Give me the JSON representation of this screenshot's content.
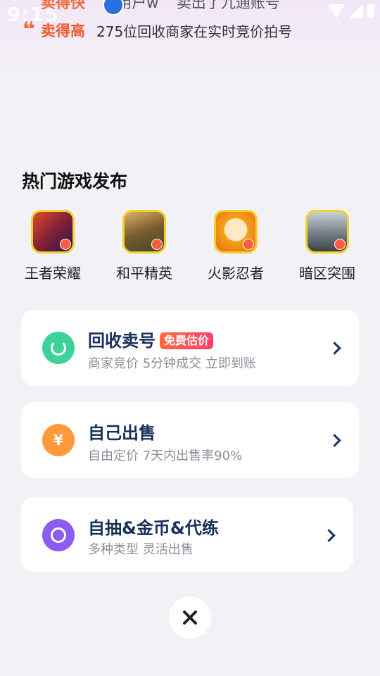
{
  "status_bar": {
    "time": "9:15",
    "icons": [
      "image-icon",
      "download-icon",
      "font-icon",
      "wifi-icon",
      "signal-icon",
      "battery-icon"
    ]
  },
  "ticker": {
    "prev_highlight": "卖得快",
    "prev_user": "用户w",
    "prev_text": "卖出了九通账号",
    "highlight": "卖得高",
    "text": "275位回收商家在实时竞价拍号"
  },
  "hot_games": {
    "title": "热门游戏发布",
    "items": [
      {
        "label": "王者荣耀",
        "color": "#c9402f"
      },
      {
        "label": "和平精英",
        "color": "#7a5a2e"
      },
      {
        "label": "火影忍者",
        "color": "#f3a21a"
      },
      {
        "label": "暗区突围",
        "color": "#5a6670"
      }
    ]
  },
  "cards": [
    {
      "title": "回收卖号",
      "badge": "免费估价",
      "subtitle": "商家竞价 5分钟成交 立即到账",
      "icon": "recycle-icon",
      "color": "#3ed19a"
    },
    {
      "title": "自己出售",
      "subtitle": "自由定价 7天内出售率90%",
      "icon": "yen-icon",
      "icon_text": "¥",
      "color": "#ff9a3c"
    },
    {
      "title": "自抽&金币&代练",
      "subtitle": "多种类型 灵活出售",
      "icon": "ring-icon",
      "color": "#8a5cf2"
    }
  ],
  "colors": {
    "accent": "#f25a2e",
    "title": "#16305a",
    "subtitle": "#8a8f99",
    "background": "#f2f2f6"
  }
}
